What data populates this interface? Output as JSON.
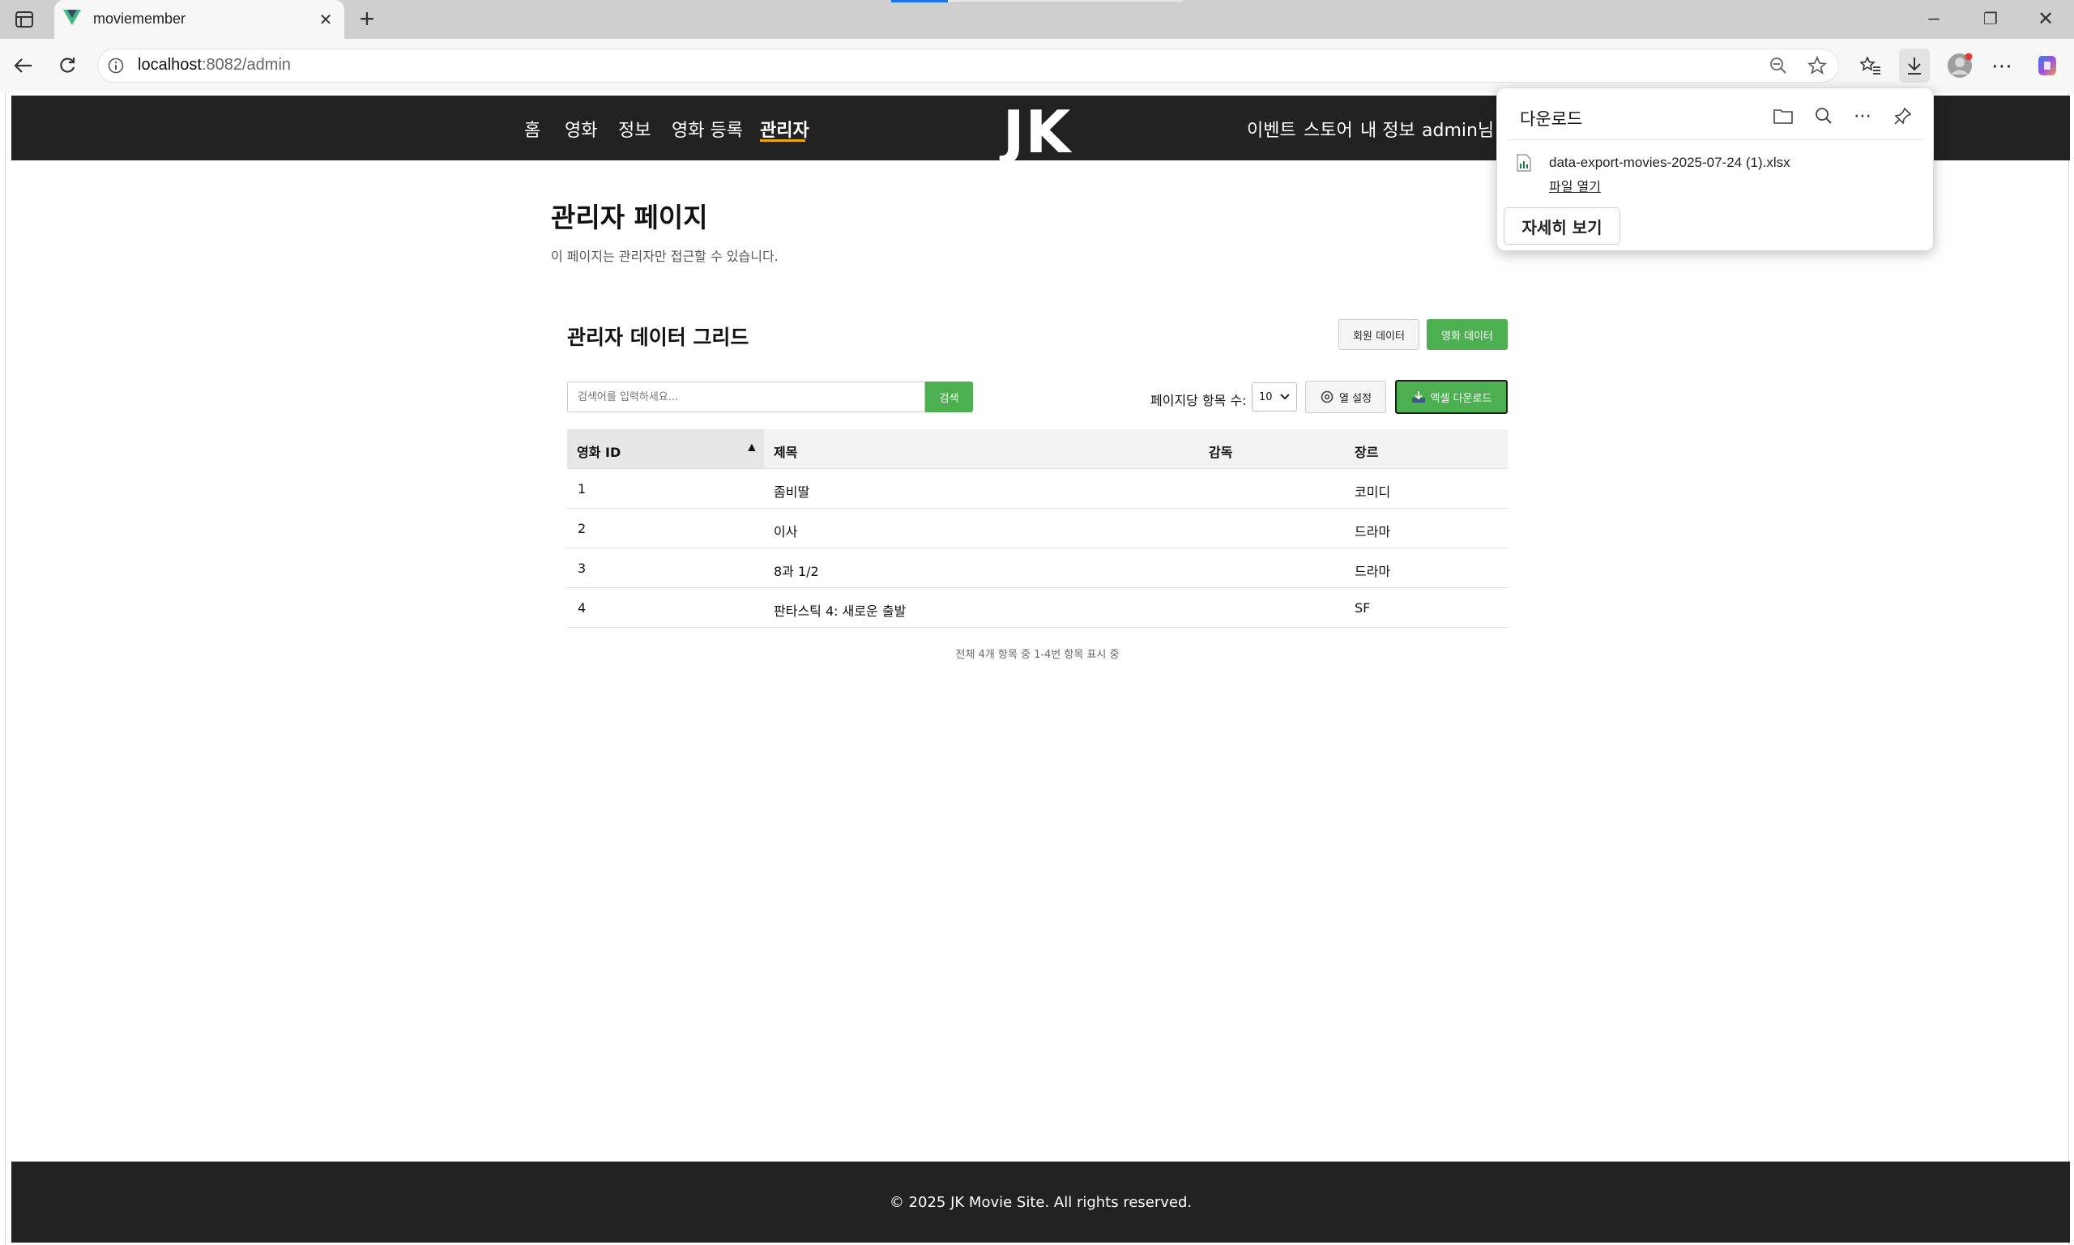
{
  "browser": {
    "tab_title": "moviemember",
    "url_host": "localhost",
    "url_rest": ":8082/admin",
    "new_tab": "+",
    "min": "–",
    "restore": "❐",
    "close": "✕"
  },
  "nav": {
    "left": [
      "홈",
      "영화",
      "정보",
      "영화 등록",
      "관리자"
    ],
    "logo": "JK MOVIE",
    "right": [
      "이벤트",
      "스토어",
      "내 정보",
      "admin님"
    ]
  },
  "admin": {
    "title": "관리자 페이지",
    "subtitle": "이 페이지는 관리자만 접근할 수 있습니다."
  },
  "grid": {
    "title": "관리자 데이터 그리드",
    "btn_members": "회원 데이터",
    "btn_movies": "영화 데이터",
    "search_placeholder": "검색어를 입력하세요...",
    "search_btn": "검색",
    "per_page_label": "페이지당 항목 수:",
    "per_page_value": "10",
    "col_settings": "열 설정",
    "excel_download": "엑셀 다운로드",
    "sort_indicator": "▲",
    "columns": [
      "영화 ID",
      "제목",
      "감독",
      "장르"
    ],
    "rows": [
      [
        "1",
        "좀비딸",
        "",
        "코미디"
      ],
      [
        "2",
        "이사",
        "",
        "드라마"
      ],
      [
        "3",
        "8과 1/2",
        "",
        "드라마"
      ],
      [
        "4",
        "판타스틱 4: 새로운 출발",
        "",
        "SF"
      ]
    ],
    "summary": "전체 4개 항목 중 1-4번 항목 표시 중"
  },
  "download": {
    "title": "다운로드",
    "file_name": "data-export-movies-2025-07-24 (1).xlsx",
    "open_file": "파일 열기",
    "more": "자세히 보기"
  },
  "footer": {
    "text": "© 2025 JK Movie Site. All rights reserved."
  },
  "colors": {
    "header_bg": "#222222",
    "accent_green": "#4caf50",
    "active_underline": "#f0a500"
  }
}
